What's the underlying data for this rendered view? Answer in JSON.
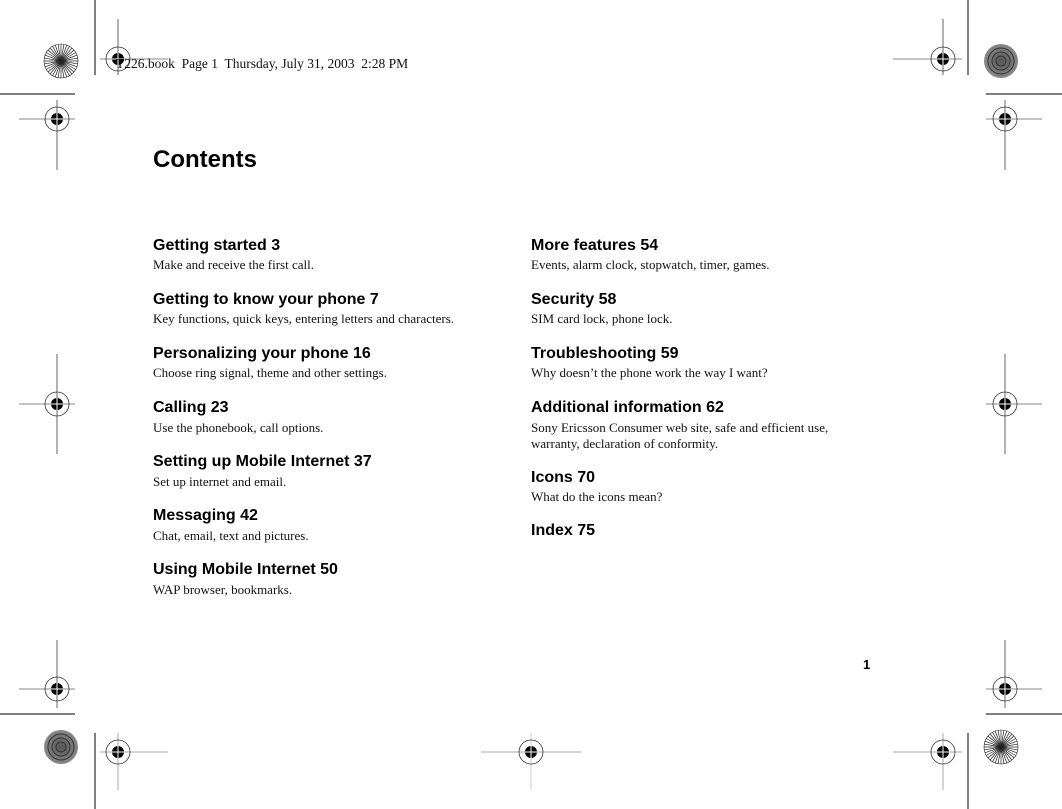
{
  "header": {
    "slug": "T226.book  Page 1  Thursday, July 31, 2003  2:28 PM"
  },
  "page": {
    "title": "Contents",
    "page_number": "1"
  },
  "toc": {
    "left": [
      {
        "heading": "Getting started 3",
        "description": "Make and receive the first call."
      },
      {
        "heading": "Getting to know your phone 7",
        "description": "Key functions, quick keys, entering letters and characters."
      },
      {
        "heading": "Personalizing your phone 16",
        "description": "Choose ring signal, theme and other settings."
      },
      {
        "heading": "Calling 23",
        "description": "Use the phonebook, call options."
      },
      {
        "heading": "Setting up Mobile Internet 37",
        "description": "Set up internet and email."
      },
      {
        "heading": "Messaging 42",
        "description": "Chat, email, text and pictures."
      },
      {
        "heading": "Using Mobile Internet 50",
        "description": "WAP browser, bookmarks."
      }
    ],
    "right": [
      {
        "heading": "More features 54",
        "description": "Events, alarm clock, stopwatch, timer, games."
      },
      {
        "heading": "Security 58",
        "description": "SIM card lock, phone lock."
      },
      {
        "heading": "Troubleshooting 59",
        "description": "Why doesn’t the phone work the way I want?"
      },
      {
        "heading": "Additional information 62",
        "description": "Sony Ericsson Consumer web site, safe and efficient use, warranty, declaration of conformity."
      },
      {
        "heading": "Icons 70",
        "description": "What do the icons mean?"
      },
      {
        "heading": "Index 75",
        "description": ""
      }
    ]
  },
  "print_marks": {
    "registration_mark_icon": "crosshair-target",
    "color_bar_icon": "starburst-circle"
  }
}
